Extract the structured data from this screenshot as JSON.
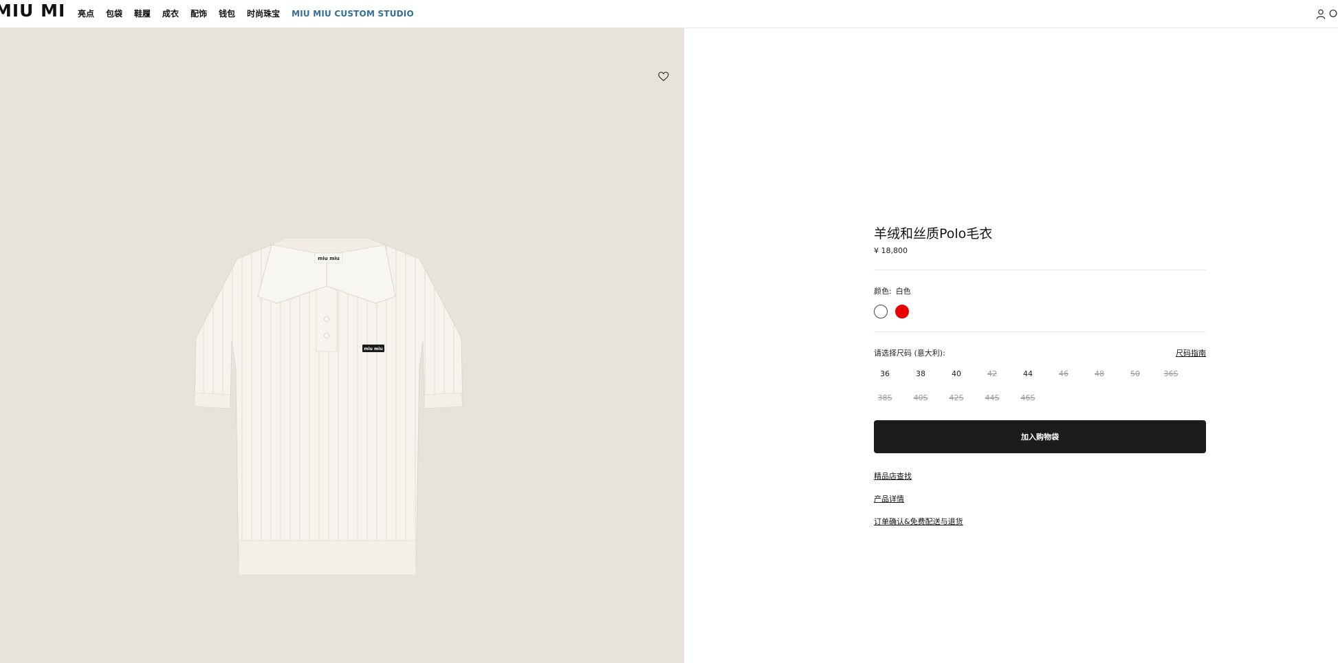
{
  "header": {
    "logo_text": "MIU MIU",
    "nav": [
      "亮点",
      "包袋",
      "鞋履",
      "成衣",
      "配饰",
      "钱包",
      "时尚珠宝",
      "MIU MIU CUSTOM STUDIO"
    ],
    "icons": [
      "user-icon",
      "search-icon"
    ]
  },
  "product": {
    "title": "羊绒和丝质Polo毛衣",
    "price": "¥ 18,800",
    "color_label": "颜色:",
    "color_value": "白色",
    "swatches": [
      {
        "name": "white",
        "color": "#ffffff",
        "selected": true
      },
      {
        "name": "red",
        "color": "#e80000",
        "selected": false
      }
    ],
    "size_label": "请选择尺码 (意大利):",
    "size_guide": "尺码指南",
    "sizes": [
      {
        "label": "36",
        "available": true
      },
      {
        "label": "38",
        "available": true
      },
      {
        "label": "40",
        "available": true
      },
      {
        "label": "42",
        "available": false
      },
      {
        "label": "44",
        "available": true
      },
      {
        "label": "46",
        "available": false
      },
      {
        "label": "48",
        "available": false
      },
      {
        "label": "50",
        "available": false
      },
      {
        "label": "36S",
        "available": false
      },
      {
        "label": "38S",
        "available": false
      },
      {
        "label": "40S",
        "available": false
      },
      {
        "label": "42S",
        "available": false
      },
      {
        "label": "44S",
        "available": false
      },
      {
        "label": "46S",
        "available": false
      }
    ],
    "add_to_bag": "加入购物袋",
    "links": [
      "精品店查找",
      "产品详情",
      "订单确认&免费配送与退货"
    ],
    "image_label_text": "miu miu"
  },
  "colors": {
    "image_bg": "#e8e3da",
    "button_bg": "#1c1c1e",
    "accent": "#2f6f9a"
  }
}
